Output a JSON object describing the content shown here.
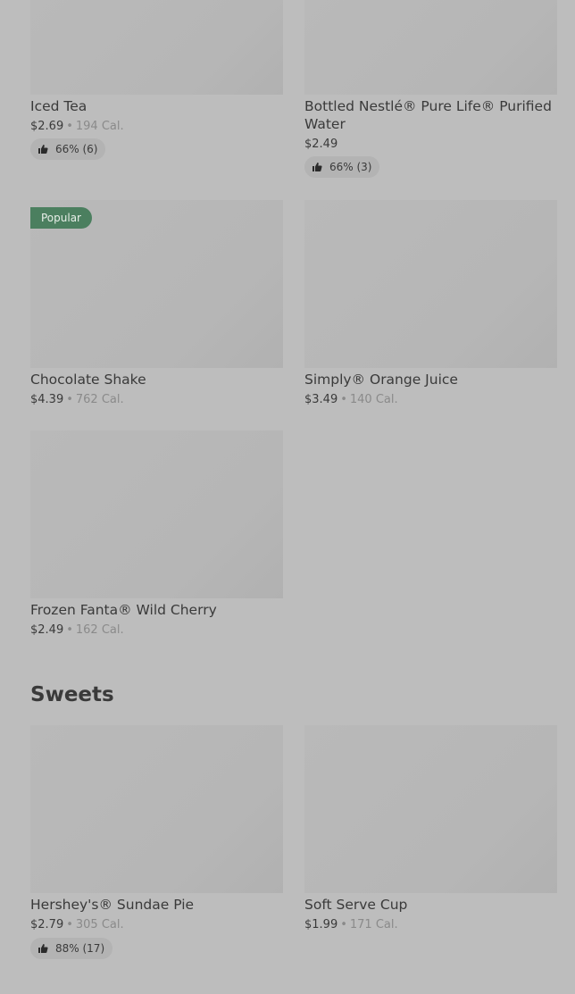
{
  "items": [
    {
      "name": "Iced Tea",
      "price": "$2.69",
      "sep": "•",
      "cal": "194 Cal.",
      "rating": "66% (6)"
    },
    {
      "name": "Bottled Nestlé® Pure Life® Purified Water",
      "price": "$2.49",
      "rating": "66% (3)"
    },
    {
      "name": "Chocolate Shake",
      "price": "$4.39",
      "sep": "•",
      "cal": "762 Cal.",
      "badge": "Popular"
    },
    {
      "name": "Simply® Orange Juice",
      "price": "$3.49",
      "sep": "•",
      "cal": "140 Cal."
    },
    {
      "name": "Frozen Fanta® Wild Cherry",
      "price": "$2.49",
      "sep": "•",
      "cal": "162 Cal."
    }
  ],
  "sections": {
    "sweets": {
      "title": "Sweets",
      "items": [
        {
          "name": "Hershey's® Sundae Pie",
          "price": "$2.79",
          "sep": "•",
          "cal": "305 Cal.",
          "rating": "88% (17)"
        },
        {
          "name": "Soft Serve Cup",
          "price": "$1.99",
          "sep": "•",
          "cal": "171 Cal."
        }
      ]
    }
  }
}
